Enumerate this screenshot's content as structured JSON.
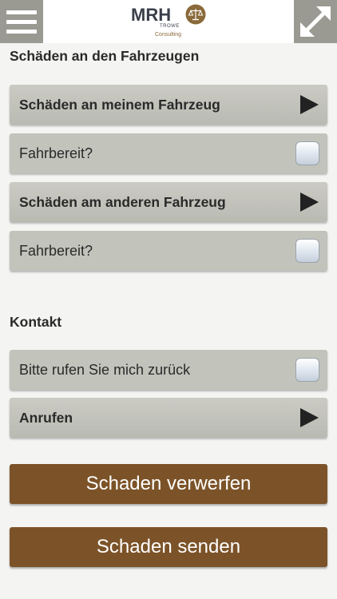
{
  "header": {
    "logo": {
      "main": "MRH",
      "sub1": "TROWE",
      "sub2": "Consulting"
    },
    "menu_icon": "hamburger-icon",
    "expand_icon": "expand-arrows-icon",
    "colors": {
      "bar_button": "#9a9a92",
      "logo_text": "#3a3f4a",
      "logo_accent": "#8a6a3a"
    }
  },
  "vehicles": {
    "title": "Schäden an den Fahrzeugen",
    "own_damage": "Schäden an meinem Fahrzeug",
    "own_driveable": "Fahrbereit?",
    "other_damage": "Schäden am anderen Fahrzeug",
    "other_driveable": "Fahrbereit?"
  },
  "contact": {
    "title": "Kontakt",
    "callback": "Bitte rufen Sie mich zurück",
    "call": "Anrufen"
  },
  "actions": {
    "discard": "Schaden verwerfen",
    "send": "Schaden senden",
    "button_color": "#7c5328"
  }
}
